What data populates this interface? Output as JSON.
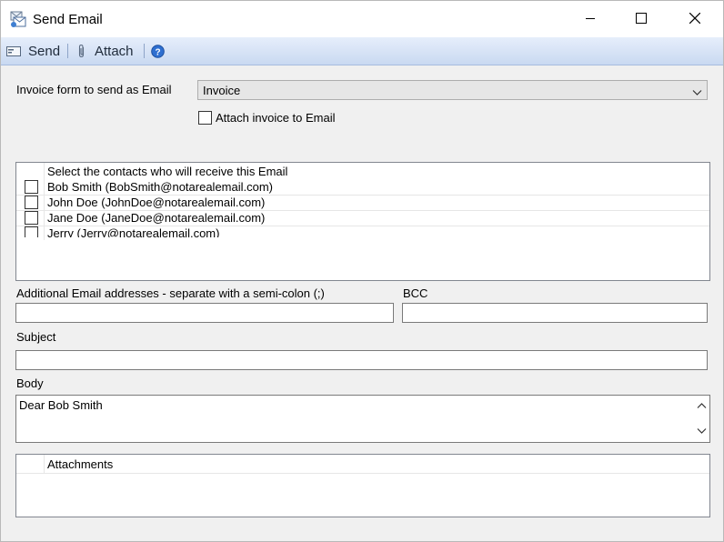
{
  "window": {
    "title": "Send Email",
    "minimize_icon": "minimize-icon",
    "maximize_icon": "maximize-icon",
    "close_icon": "close-icon"
  },
  "toolbar": {
    "send_label": "Send",
    "attach_label": "Attach",
    "help_icon": "help-icon"
  },
  "form": {
    "invoice_label": "Invoice form to send as Email",
    "invoice_value": "Invoice",
    "attach_invoice_label": "Attach invoice to Email",
    "attach_invoice_checked": false
  },
  "contacts": {
    "header": "Select the contacts who will receive this Email",
    "items": [
      {
        "label": "Bob Smith (BobSmith@notarealemail.com)",
        "checked": false
      },
      {
        "label": "John Doe (JohnDoe@notarealemail.com)",
        "checked": false
      },
      {
        "label": "Jane Doe (JaneDoe@notarealemail.com)",
        "checked": false
      },
      {
        "label": "Jerry (Jerry@notarealemail.com)",
        "checked": false
      }
    ]
  },
  "additional": {
    "label": "Additional Email addresses - separate with a semi-colon (;)",
    "value": ""
  },
  "bcc": {
    "label": "BCC",
    "value": ""
  },
  "subject": {
    "label": "Subject",
    "value": ""
  },
  "body": {
    "label": "Body",
    "value": "Dear Bob Smith"
  },
  "attachments": {
    "header": "Attachments"
  },
  "colors": {
    "toolbar_top": "#e6eefb",
    "toolbar_bottom": "#c9d9f1",
    "window_bg": "#f0f0f0"
  }
}
